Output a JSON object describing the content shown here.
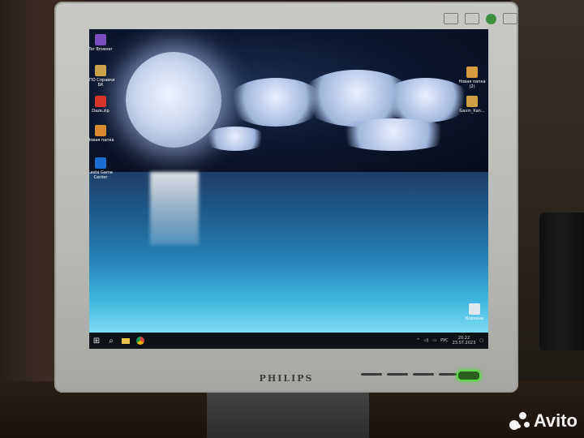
{
  "monitor": {
    "brand": "PHILIPS"
  },
  "desktop": {
    "icons": [
      {
        "label": "Tor Browser",
        "color": "#7a4fbf",
        "icon": "tor-browser-icon"
      },
      {
        "label": "СПО Справки БК",
        "color": "#c9a24a",
        "icon": "spravki-bk-icon"
      },
      {
        "label": "Daze.zip",
        "color": "#d8342b",
        "icon": "archive-icon"
      },
      {
        "label": "Новая папка",
        "color": "#d88a2e",
        "icon": "folder-icon"
      },
      {
        "label": "Lesta Game Center",
        "color": "#1c6fd1",
        "icon": "lesta-icon"
      }
    ],
    "right_icons": [
      {
        "label": "Новая папка (2)",
        "color": "#d89a3e",
        "icon": "folder-icon"
      },
      {
        "label": "Gavin_Kan...",
        "color": "#cfa043",
        "icon": "archive-icon"
      }
    ],
    "recycle_bin": {
      "label": "Корзина",
      "icon": "recycle-bin-icon"
    }
  },
  "taskbar": {
    "start": "start-icon",
    "search": "search-icon",
    "apps": [
      "file-explorer-icon",
      "chrome-icon"
    ],
    "language": "РУС",
    "time": "20:22",
    "date": "23.07.2023"
  },
  "watermark": {
    "text": "Avito"
  }
}
